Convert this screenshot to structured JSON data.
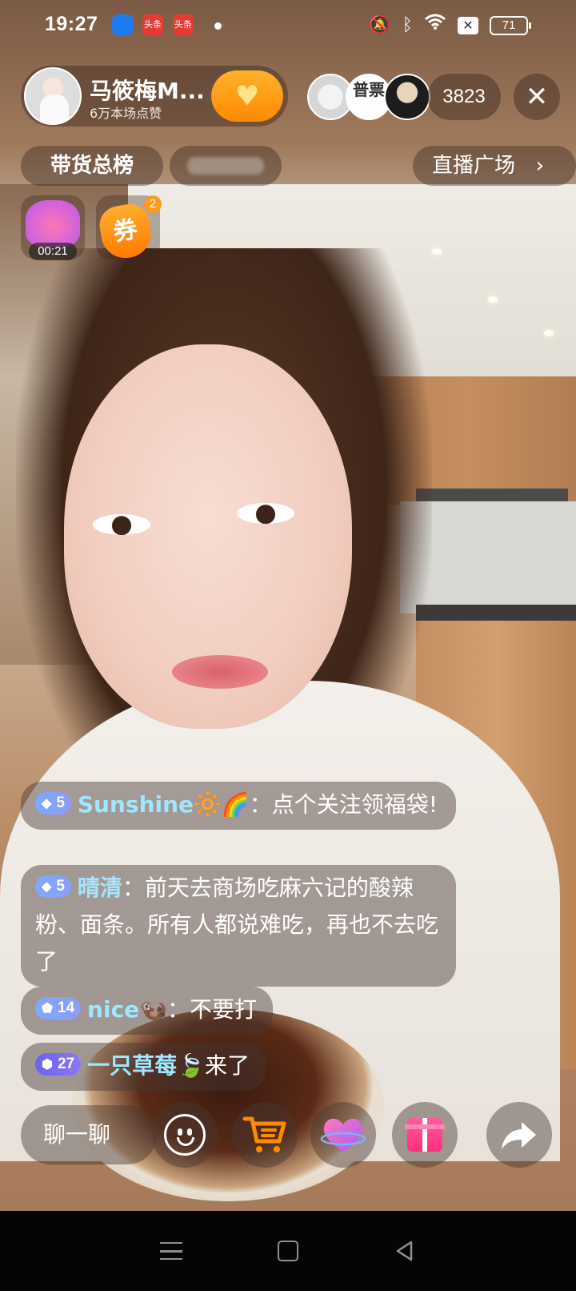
{
  "status_bar": {
    "time": "19:27",
    "app_icons": [
      "blue-app-icon",
      "toutiao-icon",
      "toutiao-icon"
    ],
    "app_icon_labels": [
      "头条",
      "头条"
    ],
    "battery": "71",
    "icons": [
      "mute-bell-icon",
      "bluetooth-icon",
      "wifi-icon",
      "x-box-icon",
      "battery-icon"
    ]
  },
  "host": {
    "name": "马筱梅M...",
    "likes": "6万本场点赞",
    "follow_icon": "heart-plus-icon"
  },
  "viewers": {
    "badge_text": "普票",
    "count": "3823"
  },
  "tabs": {
    "rank": "带货总榜",
    "plaza": "直播广场"
  },
  "badges": {
    "timer": "00:21",
    "coupon_label": "券",
    "coupon_count": "2"
  },
  "chat": [
    {
      "level": "5",
      "level_style": "blue",
      "user": "Sunshine🔆🌈",
      "sep": "：",
      "text": "点个关注领福袋!"
    },
    {
      "level": "5",
      "level_style": "blue",
      "user": "晴清",
      "sep": "：",
      "text": "前天去商场吃麻六记的酸辣粉、面条。所有人都说难吃，再也不去吃了"
    },
    {
      "level": "14",
      "level_style": "blue",
      "user": "nice🦦",
      "sep": "：",
      "text": "不要打"
    },
    {
      "level": "27",
      "level_style": "purple",
      "user": "一只草莓🍃",
      "sep": "",
      "text": "来了"
    }
  ],
  "bottom": {
    "input_placeholder": "聊一聊",
    "buttons": [
      "emoji-icon",
      "cart-icon",
      "heart-icon",
      "gift-icon",
      "share-icon"
    ]
  },
  "colors": {
    "accent_orange": "#ff8a00",
    "username_blue": "#9ee7ff",
    "level_blue": "#7fa8ff",
    "level_purple": "#6a62f0"
  }
}
